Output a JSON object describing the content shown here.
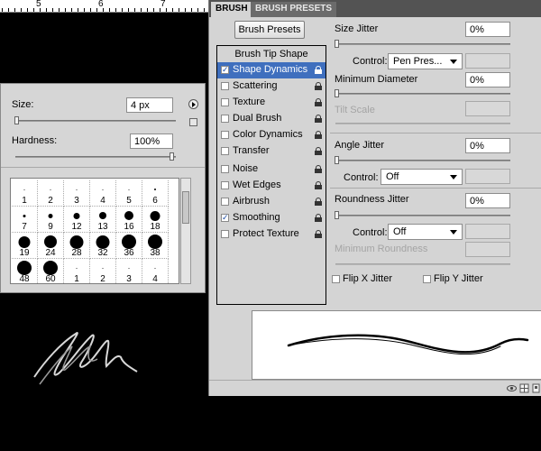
{
  "ruler": {
    "labels": [
      "5",
      "6",
      "7"
    ]
  },
  "picker": {
    "size_label": "Size:",
    "size_value": "4 px",
    "hardness_label": "Hardness:",
    "hardness_value": "100%",
    "presets": [
      "1",
      "3",
      "3",
      "4",
      "5",
      "6",
      "7",
      "9",
      "12",
      "13",
      "16",
      "18",
      "19",
      "24",
      "28",
      "32",
      "36",
      "38",
      "48",
      "60",
      "1",
      "2",
      "3",
      "4"
    ],
    "preset_labels": [
      "1",
      "2",
      "3",
      "4",
      "5",
      "6",
      "7",
      "9",
      "12",
      "13",
      "16",
      "18",
      "19",
      "24",
      "28",
      "32",
      "36",
      "38",
      "48",
      "60",
      "1",
      "2",
      "3",
      "4"
    ]
  },
  "tabs": {
    "active": "BRUSH",
    "inactive": "BRUSH PRESETS"
  },
  "brush_presets_button": "Brush Presets",
  "list": {
    "header": "Brush Tip Shape",
    "items": [
      {
        "label": "Shape Dynamics",
        "checked": true,
        "selected": true
      },
      {
        "label": "Scattering",
        "checked": false
      },
      {
        "label": "Texture",
        "checked": false
      },
      {
        "label": "Dual Brush",
        "checked": false
      },
      {
        "label": "Color Dynamics",
        "checked": false
      },
      {
        "label": "Transfer",
        "checked": false
      },
      {
        "label": "Noise",
        "checked": false
      },
      {
        "label": "Wet Edges",
        "checked": false
      },
      {
        "label": "Airbrush",
        "checked": false
      },
      {
        "label": "Smoothing",
        "checked": true
      },
      {
        "label": "Protect Texture",
        "checked": false
      }
    ]
  },
  "options": {
    "size_jitter_label": "Size Jitter",
    "size_jitter_value": "0%",
    "control_label": "Control:",
    "size_control_value": "Pen Pres...",
    "min_diameter_label": "Minimum Diameter",
    "min_diameter_value": "0%",
    "tilt_scale_label": "Tilt Scale",
    "angle_jitter_label": "Angle Jitter",
    "angle_jitter_value": "0%",
    "angle_control_value": "Off",
    "roundness_jitter_label": "Roundness Jitter",
    "roundness_jitter_value": "0%",
    "roundness_control_value": "Off",
    "min_roundness_label": "Minimum Roundness",
    "flip_x_label": "Flip X Jitter",
    "flip_y_label": "Flip Y Jitter"
  }
}
